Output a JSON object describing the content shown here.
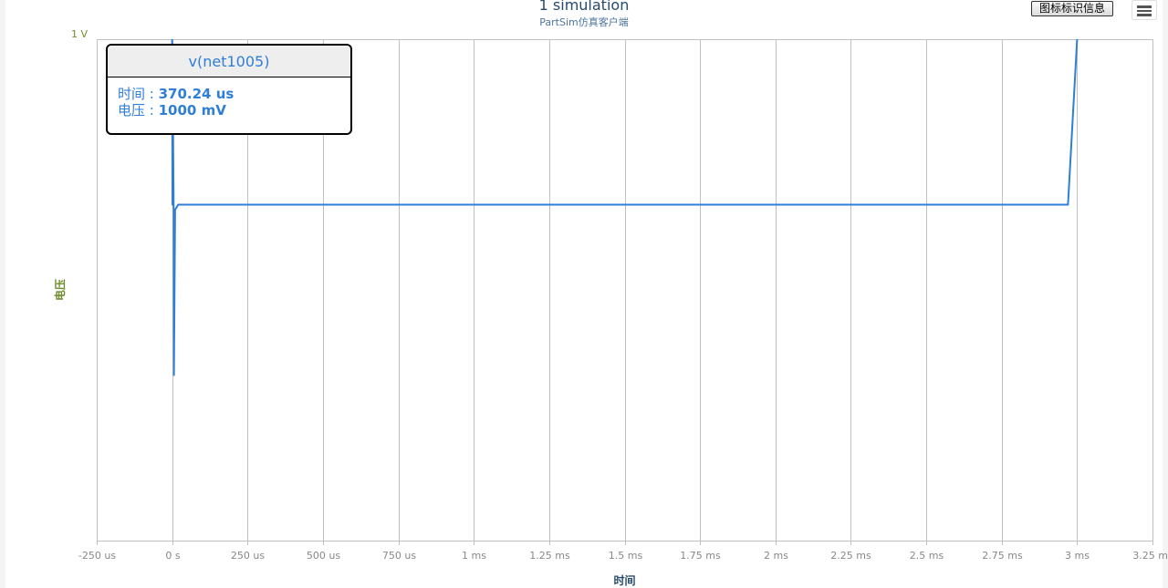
{
  "title": "1 simulation",
  "subtitle": "PartSim仿真客户端",
  "buttons": {
    "legend_info": "图标标识信息",
    "menu_icon": "hamburger-menu-icon"
  },
  "tooltip": {
    "series": "v(net1005)",
    "time_label": "时间 : ",
    "time_value": "370.24 us",
    "voltage_label": "电压 : ",
    "voltage_value": "1000 mV"
  },
  "colors": {
    "series": "#2f7ed8",
    "title": "#274b6d",
    "subtitle": "#4d759e",
    "ylabel": "#6d8b2d",
    "grid": "#c0c0c0",
    "tick": "#888888"
  },
  "chart_data": {
    "type": "line",
    "title": "1 simulation",
    "subtitle": "PartSim仿真客户端",
    "xlabel": "时间",
    "ylabel": "电压",
    "x_unit": "us",
    "xlim": [
      -250,
      3250
    ],
    "ylim": [
      0,
      1
    ],
    "x_ticks": [
      -250,
      0,
      250,
      500,
      750,
      1000,
      1250,
      1500,
      1750,
      2000,
      2250,
      2500,
      2750,
      3000,
      3250
    ],
    "x_tick_labels": [
      "-250 us",
      "0 s",
      "250 us",
      "500 us",
      "750 us",
      "1 ms",
      "1.25 ms",
      "1.5 ms",
      "1.75 ms",
      "2 ms",
      "2.25 ms",
      "2.5 ms",
      "2.75 ms",
      "3 ms",
      "3.25 ms"
    ],
    "y_tick_labels": [
      "1 V"
    ],
    "grid": true,
    "series": [
      {
        "name": "v(net1005)",
        "x": [
          0,
          1,
          2,
          5,
          6,
          10,
          20,
          2970,
          3000
        ],
        "y": [
          1,
          0.67,
          0.9,
          0.66,
          0.33,
          0.66,
          0.67,
          0.67,
          1
        ]
      }
    ]
  }
}
